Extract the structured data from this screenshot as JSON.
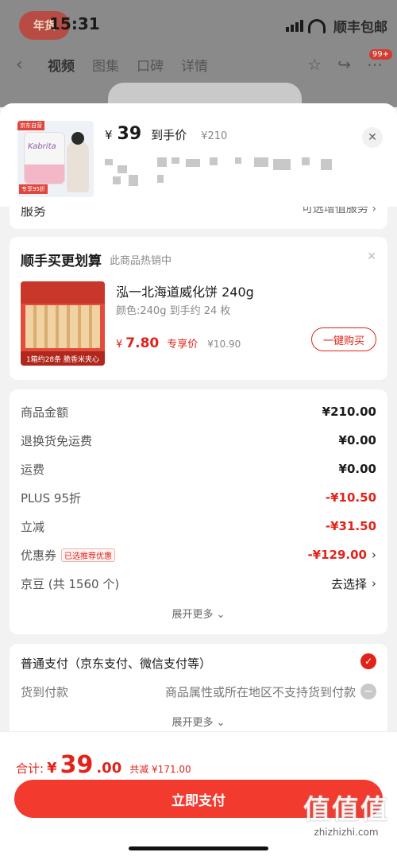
{
  "status_bar": {
    "time": "15:31",
    "badge_text": "顺丰包邮"
  },
  "bg_nav": {
    "logo_text": "年货",
    "back": "‹",
    "tabs": [
      "视频",
      "图集",
      "口碑",
      "详情"
    ],
    "cart_count": "99+"
  },
  "product": {
    "price_yen": "¥",
    "price": "39",
    "price_label": "到手价",
    "original_price": "¥210",
    "image_brand": "Kabrita",
    "image_tag": "京东自营",
    "image_off": "专享95折"
  },
  "service": {
    "label": "服务",
    "value": "可选增值服务"
  },
  "bundle": {
    "title": "顺手买更划算",
    "subtitle": "此商品热销中",
    "name": "泓一北海道威化饼 240g",
    "spec": "颜色:240g 到手约 24 枚",
    "price_yen": "¥",
    "price": "7.80",
    "price_label": "专享价",
    "original_price": "¥10.90",
    "buy_label": "一键购买",
    "img_caption": "1箱约28条 脆香米夹心"
  },
  "summary": {
    "rows": [
      {
        "key": "商品金额",
        "value": "¥210.00"
      },
      {
        "key": "退换货免运费",
        "value": "¥0.00"
      },
      {
        "key": "运费",
        "value": "¥0.00"
      },
      {
        "key": "PLUS 95折",
        "value": "-¥10.50"
      },
      {
        "key": "立减",
        "value": "-¥31.50"
      },
      {
        "key": "优惠券",
        "value": "-¥129.00",
        "badge": "已选推荐优惠"
      },
      {
        "key": "京豆 (共 1560 个)",
        "value": "去选择"
      }
    ],
    "expand": "展开更多 ⌄"
  },
  "payment": {
    "normal": "普通支付（京东支付、微信支付等）",
    "cod_label": "货到付款",
    "cod_note": "商品属性或所在地区不支持货到付款",
    "expand": "展开更多 ⌄"
  },
  "footer": {
    "total_label": "合计:",
    "total_yen": "¥",
    "total_int": "39",
    "total_dec": ".00",
    "saved": "共减 ¥171.00",
    "pay_button": "立即支付",
    "watermark": "值值值",
    "watermark_url": "zhizhizhi.com"
  },
  "colors": {
    "accent": "#e2231a",
    "button": "#f23a2f"
  }
}
